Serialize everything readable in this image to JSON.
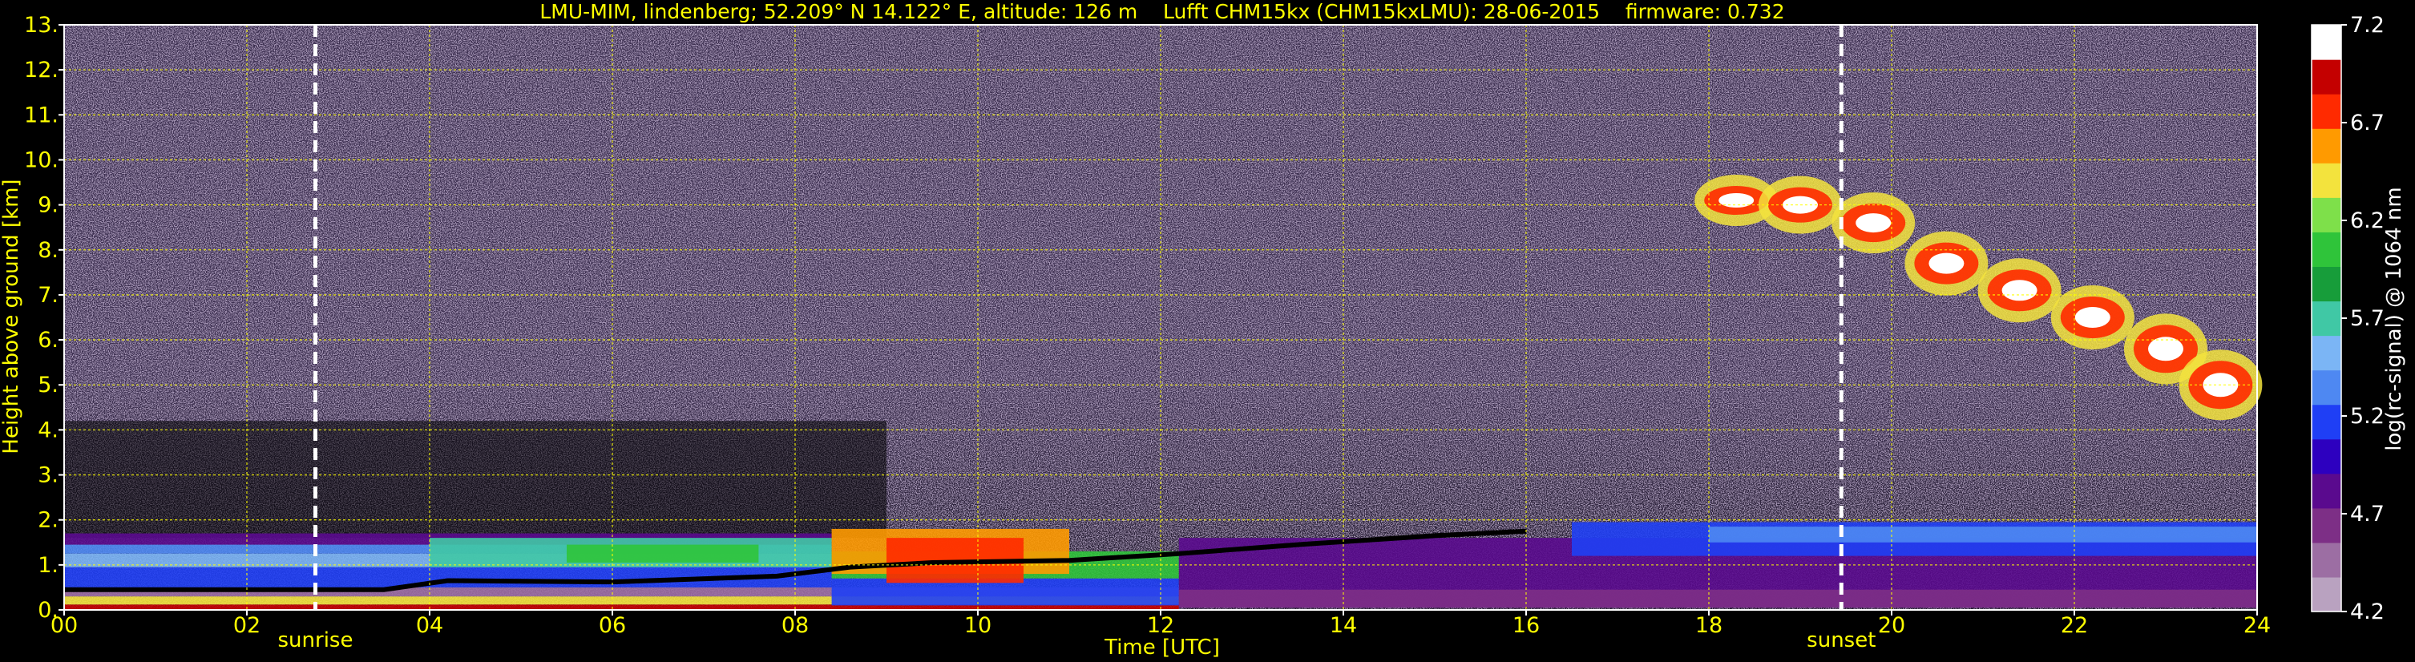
{
  "chart_data": {
    "type": "heatmap",
    "title": "LMU-MIM, lindenberg; 52.209° N 14.122° E, altitude: 126 m    Lufft CHM15kx (CHM15kxLMU): 28-06-2015    firmware: 0.732",
    "xlabel": "Time [UTC]",
    "ylabel": "Height above ground [km]",
    "xlim": [
      0,
      24
    ],
    "ylim": [
      0,
      13
    ],
    "x_ticks": [
      "00",
      "02",
      "04",
      "06",
      "08",
      "10",
      "12",
      "14",
      "16",
      "18",
      "20",
      "22",
      "24"
    ],
    "y_ticks": [
      "0.",
      "1.",
      "2.",
      "3.",
      "4.",
      "5.",
      "6.",
      "7.",
      "8.",
      "9.",
      "10.",
      "11.",
      "12.",
      "13."
    ],
    "grid": true,
    "colorbar": {
      "label": "log(rc-signal) @ 1064 nm",
      "min": 4.2,
      "max": 7.2,
      "tick_values": [
        4.2,
        4.7,
        5.2,
        5.7,
        6.2,
        6.7,
        7.2
      ],
      "tick_labels": [
        "4.2",
        "4.7",
        "5.2",
        "5.7",
        "6.2",
        "6.7",
        "7.2"
      ]
    },
    "markers": [
      {
        "label": "sunrise",
        "x": 2.75
      },
      {
        "label": "sunset",
        "x": 19.45
      }
    ],
    "colors": {
      "background": "#000000",
      "axis_text": "#ffff00",
      "marker_line": "#ffffff",
      "noise": "#4a3c5e",
      "colormap": [
        "#b9a2c0",
        "#9c6ea3",
        "#7d2f86",
        "#5a0a8e",
        "#2d00bf",
        "#1f3ff5",
        "#4e88f2",
        "#7bb5f5",
        "#40c8a5",
        "#179d3a",
        "#2fc43a",
        "#7ee04a",
        "#f3e33d",
        "#ff9a00",
        "#ff2a00",
        "#c40000",
        "#ffffff"
      ]
    }
  }
}
